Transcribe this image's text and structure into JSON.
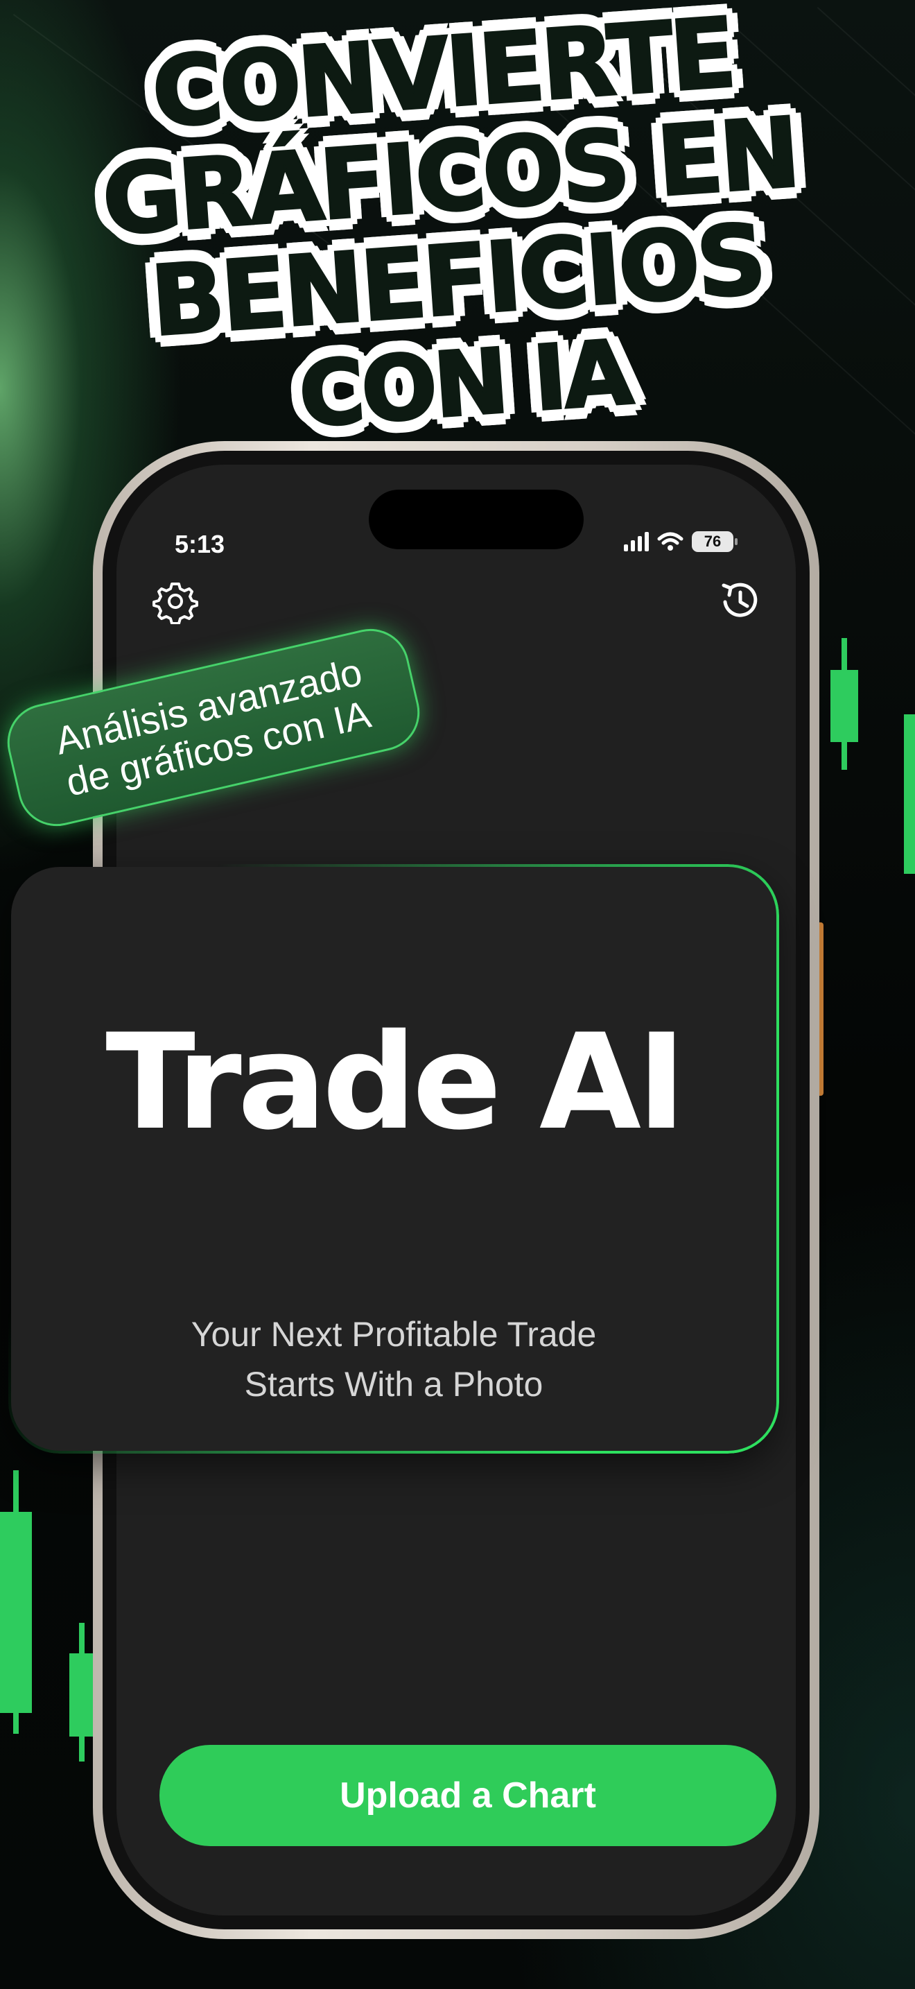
{
  "headline": {
    "line1": "CONVIERTE",
    "line2": "GRÁFICOS EN",
    "line3": "BENEFICIOS",
    "line4": "CON IA"
  },
  "badge": {
    "line1": "Análisis avanzado",
    "line2": "de gráficos con IA"
  },
  "status_bar": {
    "time": "5:13",
    "battery": "76",
    "icons": [
      "cellular-signal-icon",
      "wifi-icon",
      "battery-icon"
    ]
  },
  "toolbar": {
    "settings_icon": "gear-icon",
    "history_icon": "history-icon"
  },
  "card": {
    "title": "Trade AI",
    "subtitle_line1": "Your Next Profitable Trade",
    "subtitle_line2": "Starts With a Photo"
  },
  "upload_button": {
    "label": "Upload a Chart"
  },
  "colors": {
    "accent": "#2fcc59",
    "background": "#050807",
    "screen": "#202020",
    "card": "#222222"
  }
}
